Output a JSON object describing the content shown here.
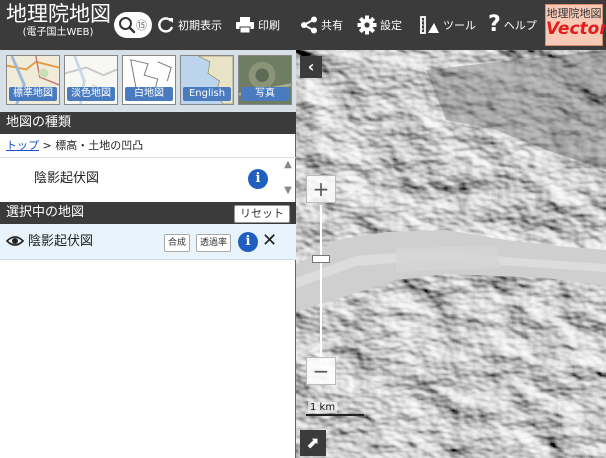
{
  "header": {
    "logo_title": "地理院地図",
    "logo_sub": "(電子国土WEB)",
    "search_pin": "⑮",
    "buttons": [
      {
        "id": "home",
        "label": "初期表示",
        "icon": "refresh-icon"
      },
      {
        "id": "print",
        "label": "印刷",
        "icon": "printer-icon"
      },
      {
        "id": "share",
        "label": "共有",
        "icon": "share-icon"
      },
      {
        "id": "settings",
        "label": "設定",
        "icon": "gear-icon"
      },
      {
        "id": "tools",
        "label": "ツール",
        "icon": "tools-icon"
      },
      {
        "id": "help",
        "label": "ヘルプ",
        "icon": "help-icon"
      }
    ],
    "vector_top": "地理院地図",
    "vector_bottom": "Vector"
  },
  "basemaps": [
    {
      "label": "標準地図"
    },
    {
      "label": "淡色地図"
    },
    {
      "label": "白地図"
    },
    {
      "label": "English"
    },
    {
      "label": "写真"
    }
  ],
  "map_types": {
    "header": "地図の種類",
    "breadcrumb_top": "トップ",
    "breadcrumb_rest": " > 標高・土地の凹凸",
    "items": [
      {
        "label": "陰影起伏図"
      }
    ],
    "info_symbol": "i"
  },
  "selected": {
    "header": "選択中の地図",
    "reset_label": "リセット",
    "layer_name": "陰影起伏図",
    "compose_label": "合成",
    "opacity_label": "透過率",
    "info_symbol": "i",
    "close_symbol": "✕"
  },
  "map": {
    "collapse_symbol": "‹",
    "zoom_in": "+",
    "zoom_out": "−",
    "scale_label": "1 km",
    "expand_symbol": "⬈"
  }
}
